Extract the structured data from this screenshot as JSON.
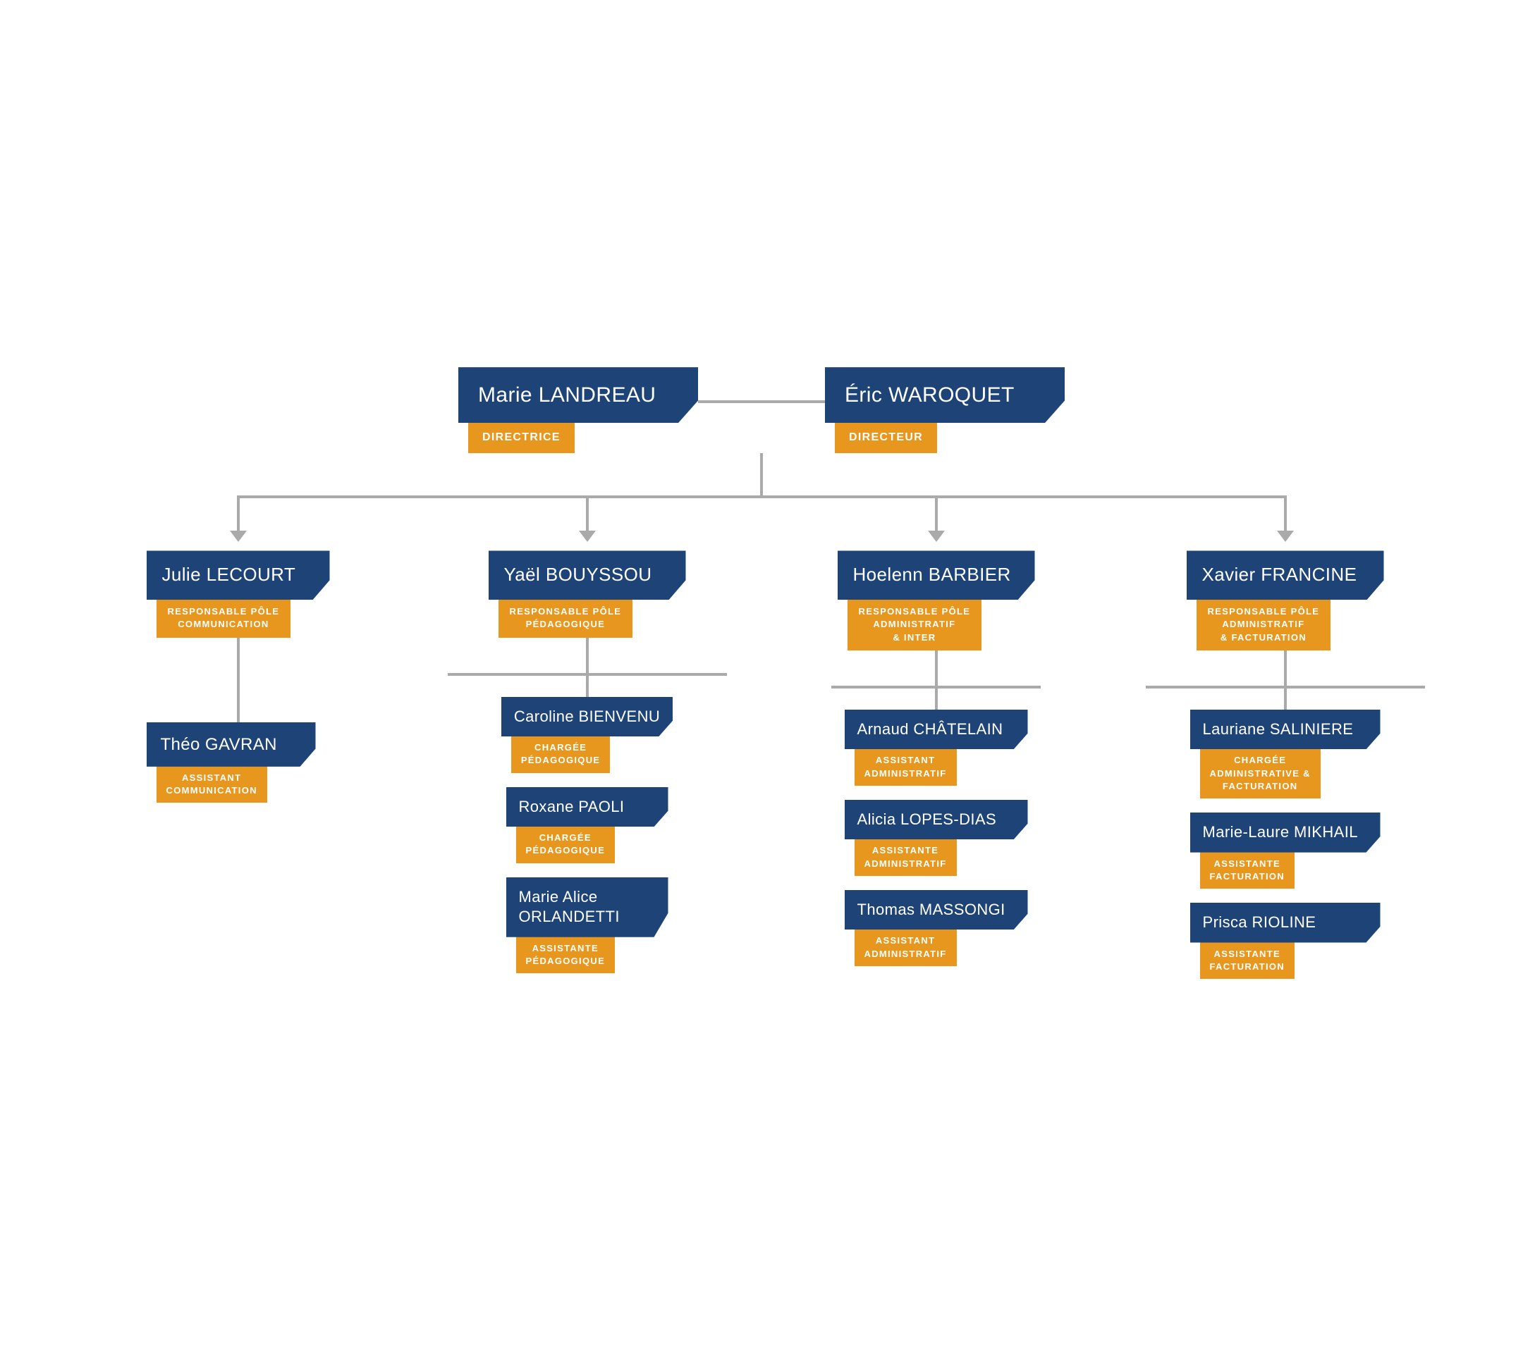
{
  "colors": {
    "navy": "#1e4477",
    "orange": "#e8971e",
    "connector": "#aaaaaa",
    "bg": "#ffffff"
  },
  "directors": [
    {
      "name": "Marie LANDREAU",
      "role": "DIRECTRICE"
    },
    {
      "name": "Éric WAROQUET",
      "role": "DIRECTEUR"
    }
  ],
  "columns": [
    {
      "id": "col1",
      "head": {
        "name": "Julie LECOURT",
        "role": "RESPONSABLE PÔLE\nCOMMUNICATION"
      },
      "children": [
        {
          "name": "Théo GAVRAN",
          "role": "ASSISTANT\nCOMMUNICATION"
        }
      ]
    },
    {
      "id": "col2",
      "head": {
        "name": "Yaël BOUYSSOU",
        "role": "RESPONSABLE PÔLE\nPÉDAGOGIQUE"
      },
      "children": [
        {
          "name": "Caroline BIENVENU",
          "role": "CHARGÉE\nPÉDAGOGIQUE"
        },
        {
          "name": "Roxane PAOLI",
          "role": "CHARGÉE\nPÉDAGOGIQUE"
        },
        {
          "name": "Marie Alice\nORLANDETTI",
          "role": "ASSISTANTE\nPÉDAGOGIQUE"
        }
      ]
    },
    {
      "id": "col3",
      "head": {
        "name": "Hoelenn BARBIER",
        "role": "RESPONSABLE PÔLE\nADMINISTRATIF\n& INTER"
      },
      "children": [
        {
          "name": "Arnaud CHÂTELAIN",
          "role": "ASSISTANT\nADMINISTRATIF"
        },
        {
          "name": "Alicia LOPES-DIAS",
          "role": "ASSISTANTE\nADMINISTRATIF"
        },
        {
          "name": "Thomas MASSONGI",
          "role": "ASSISTANT\nADMINISTRATIF"
        }
      ]
    },
    {
      "id": "col4",
      "head": {
        "name": "Xavier FRANCINE",
        "role": "RESPONSABLE PÔLE\nADMINISTRATIF\n& FACTURATION"
      },
      "children": [
        {
          "name": "Lauriane SALINIERE",
          "role": "CHARGÉE\nADMINISTRATIVE &\nFACTURATION"
        },
        {
          "name": "Marie-Laure MIKHAIL",
          "role": "ASSISTANTE\nFACTURATION"
        },
        {
          "name": "Prisca RIOLINE",
          "role": "ASSISTANTE\nFACTURATION"
        }
      ]
    }
  ]
}
